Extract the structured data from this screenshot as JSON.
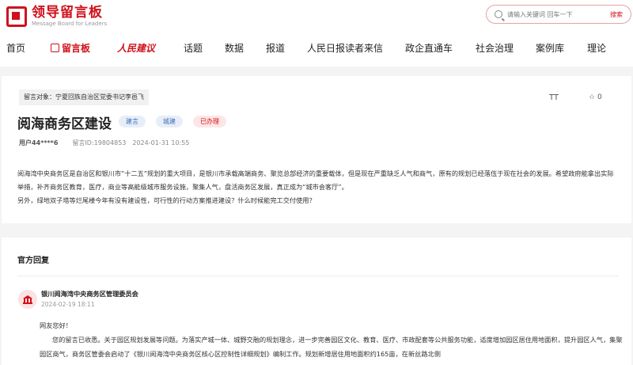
{
  "header": {
    "logo": {
      "cn": "领导留言板",
      "en": "Message Board for Leaders"
    },
    "search": {
      "placeholder": "请输入关键词 回车一下",
      "button": "搜索"
    }
  },
  "nav": {
    "items": [
      "首页",
      "留言板",
      "人民建议",
      "话题",
      "数据",
      "报道",
      "人民日报读者来信",
      "政企直通车",
      "社会治理",
      "案例库",
      "理论"
    ]
  },
  "message": {
    "target": "留言对象：宁夏回族自治区党委书记李邑飞",
    "font_toggle": "TT",
    "favorite_count": "0",
    "title": "阅海商务区建设",
    "tags": [
      "建言",
      "城建",
      "已办理"
    ],
    "user": "用户44****6",
    "message_id": "留言ID:19804853",
    "datetime": "2024-01-31 10:55",
    "paragraphs": [
      "阅海湾中央商务区是自治区和银川市“十二五”规划的重大项目，是银川市承载高端商务、聚览总部经济的重要载体，但是现在严重缺乏人气和商气，原有的规划已经落伍于现在社会的发展。希望政府能拿出实际举措，补齐商务区教育，医疗，商业等高能级城市服务设施，聚集人气，盘活商务区发展，真正成为“城市会客厅”。",
      "另外，绿地双子塔等烂尾楼今年有没有建设性，可行性的行动方案推进建设？什么时候能完工交付使用？"
    ]
  },
  "reply": {
    "heading": "官方回复",
    "org": "银川阅海湾中央商务区管理委员会",
    "time": "2024-02-19 18:11",
    "greeting": "网友您好！",
    "text": "您的留言已收悉。关于园区规划发展等问题。为落实产城一体、城野交融的规划理念，进一步完善园区文化、教育、医疗、市政配套等公共服务功能，适度增加园区居住用地面积，提升园区人气，集聚园区商气，商务区管委会启动了《银川阅海湾中央商务区核心区控制性详细规划》编制工作。规划新增居住用地面积约165亩，在新丝路北侧"
  }
}
